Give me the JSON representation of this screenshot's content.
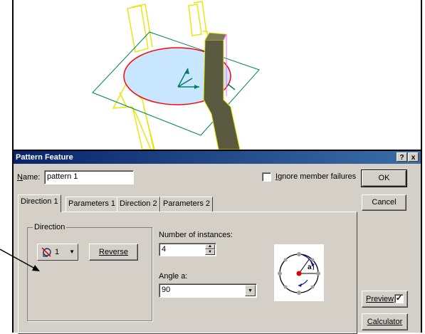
{
  "dialog": {
    "title": "Pattern Feature",
    "help_btn": "?",
    "close_btn": "x"
  },
  "name": {
    "label": "Name:",
    "value": "pattern 1"
  },
  "ignore_failures": {
    "label": "Ignore member failures",
    "checked": false
  },
  "buttons": {
    "ok": "OK",
    "cancel": "Cancel",
    "preview": "Preview",
    "preview_checked": "✓",
    "calculator": "Calculator",
    "reverse": "Reverse"
  },
  "tabs": [
    {
      "label": "Direction 1",
      "active": true
    },
    {
      "label": "Parameters 1",
      "active": false
    },
    {
      "label": "Direction 2",
      "active": false
    },
    {
      "label": "Parameters 2",
      "active": false
    }
  ],
  "direction": {
    "group_label": "Direction",
    "selected_value": "1",
    "icon": "rotation-axis-icon"
  },
  "instances": {
    "label": "Number of instances:",
    "value": "4"
  },
  "angle": {
    "label": "Angle a:",
    "value": "90"
  },
  "diagram_letter": "a",
  "colors": {
    "title_start": "#0a246a",
    "title_end": "#3a6ea5",
    "dialog_bg": "#d4d0c8",
    "model_outline": "#ffff00",
    "circle_edge": "#ff0000",
    "plane_edge": "#008060",
    "disc_fill": "#c8e6ff"
  }
}
